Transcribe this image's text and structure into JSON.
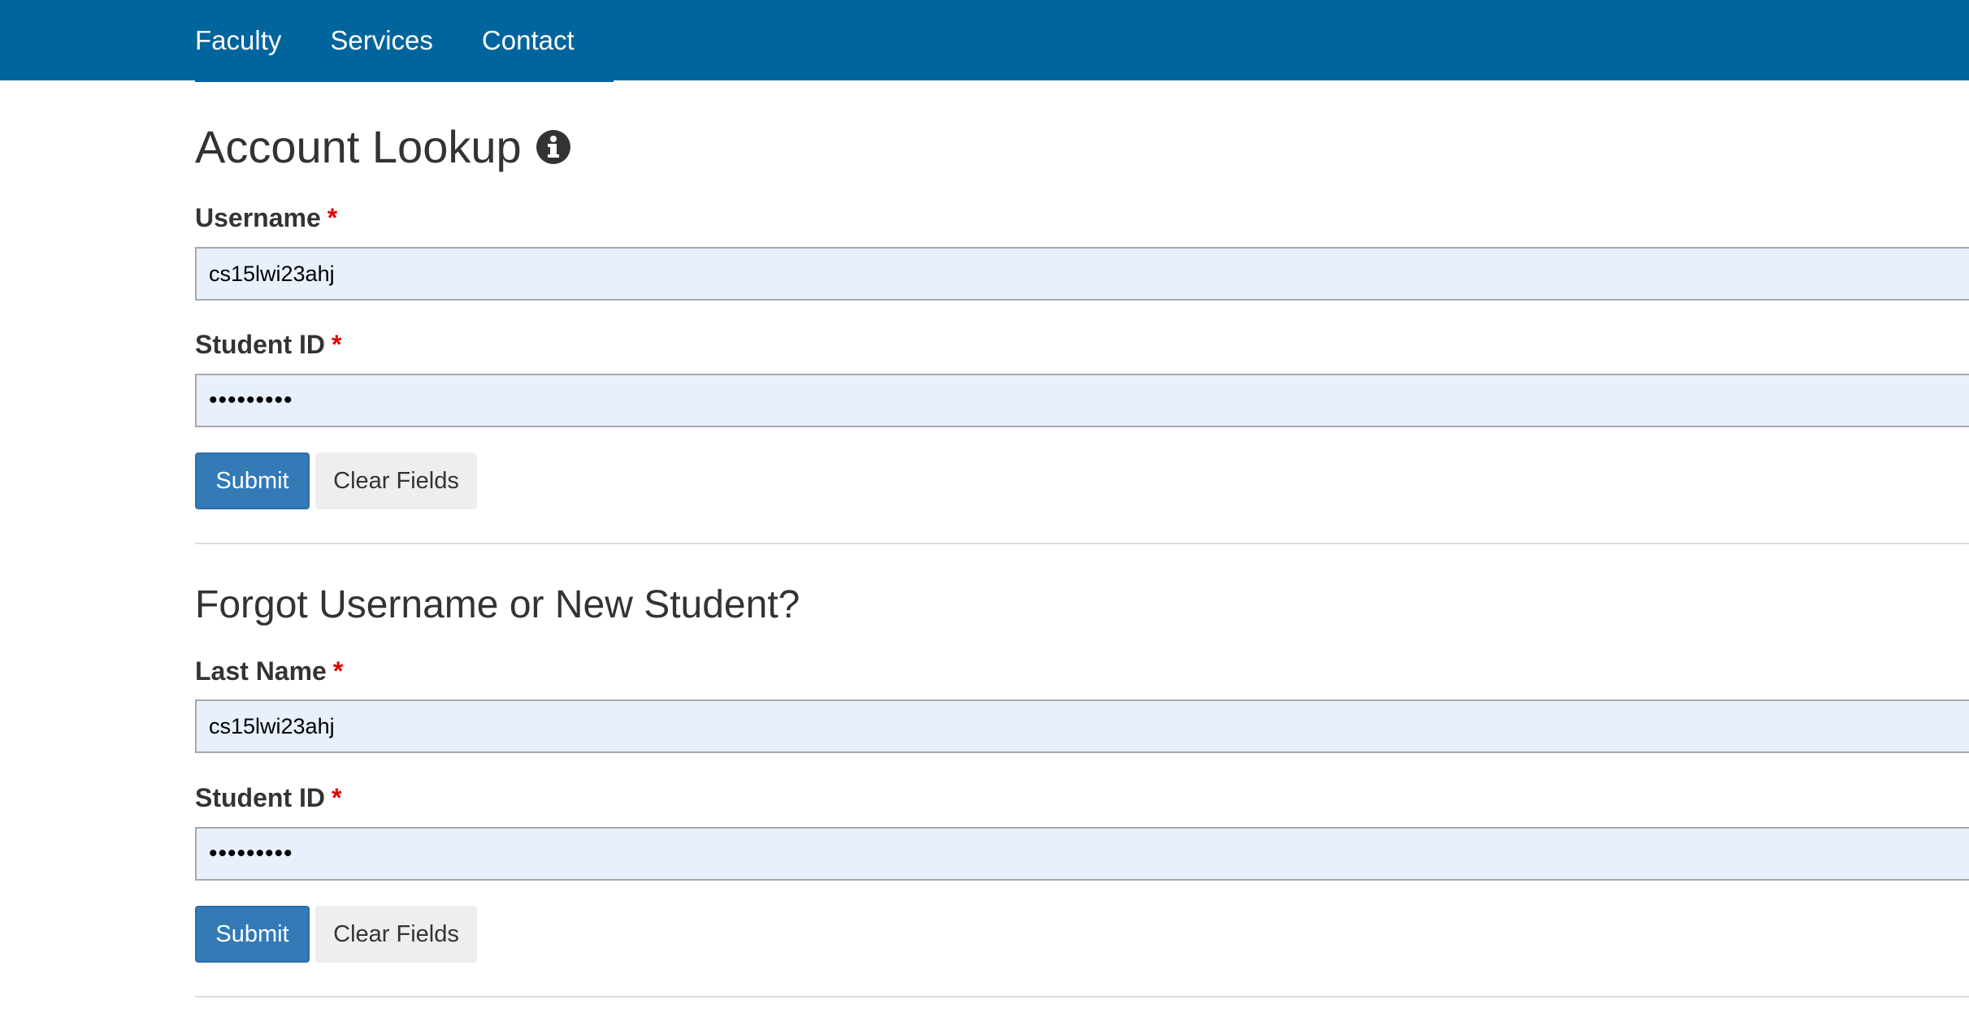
{
  "nav": {
    "items": [
      "Faculty",
      "Services",
      "Contact"
    ]
  },
  "account_lookup": {
    "title": "Account Lookup",
    "info_icon": "info-circle-icon",
    "username_label": "Username",
    "username_value": "cs15lwi23ahj",
    "student_id_label": "Student ID",
    "student_id_value": "•••••••••",
    "submit_label": "Submit",
    "clear_label": "Clear Fields"
  },
  "forgot": {
    "title": "Forgot Username or New Student?",
    "last_name_label": "Last Name",
    "last_name_value": "cs15lwi23ahj",
    "student_id_label": "Student ID",
    "student_id_value": "•••••••••",
    "submit_label": "Submit",
    "clear_label": "Clear Fields"
  },
  "required_marker": "*",
  "colors": {
    "header_bg": "#00649d",
    "primary_button": "#337ab7",
    "required": "#e00000",
    "autofill_bg": "#e8f0fe"
  }
}
